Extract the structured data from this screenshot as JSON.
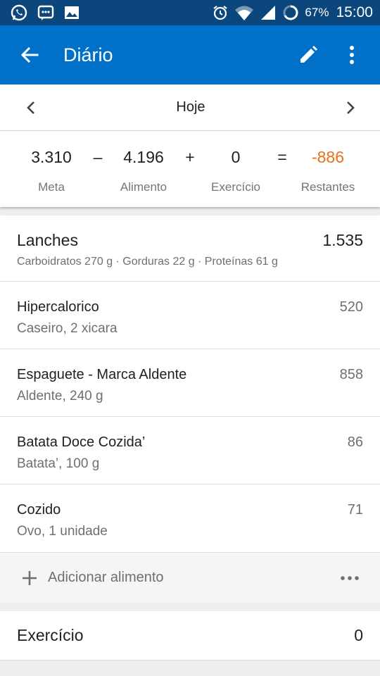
{
  "status_bar": {
    "battery_percent": "67%",
    "time": "15:00",
    "left_icons": [
      "whatsapp-icon",
      "chat-icon",
      "image-icon"
    ],
    "right_icons": [
      "alarm-icon",
      "wifi-icon",
      "signal-icon",
      "battery-icon"
    ]
  },
  "app_bar": {
    "title": "Diário",
    "icons": [
      "back-arrow-icon",
      "pencil-icon",
      "more-vertical-icon"
    ]
  },
  "day_nav": {
    "label": "Hoje"
  },
  "summary": {
    "goal": "3.310",
    "minus": "–",
    "food": "4.196",
    "plus": "+",
    "exercise": "0",
    "equals": "=",
    "remaining": "-886",
    "labels": {
      "goal": "Meta",
      "food": "Alimento",
      "exercise": "Exercício",
      "remaining": "Restantes"
    },
    "remaining_color": "#e8701a"
  },
  "meal": {
    "name": "Lanches",
    "total": "1.535",
    "macros": "Carboidratos 270 g · Gorduras 22 g · Proteínas 61 g",
    "items": [
      {
        "name": "Hipercalorico",
        "desc": "Caseiro, 2 xicara",
        "cal": "520"
      },
      {
        "name": "Espaguete - Marca Aldente",
        "desc": "Aldente, 240 g",
        "cal": "858"
      },
      {
        "name": "Batata Doce Cozida’",
        "desc": "Batata’, 100 g",
        "cal": "86"
      },
      {
        "name": "Cozido",
        "desc": "Ovo, 1 unidade",
        "cal": "71"
      }
    ],
    "add_label": "Adicionar alimento"
  },
  "exercise_section": {
    "name": "Exercício",
    "value": "0"
  },
  "colors": {
    "status_bar": "#0b467c",
    "app_bar": "#0070c8",
    "accent_negative": "#e8701a"
  }
}
